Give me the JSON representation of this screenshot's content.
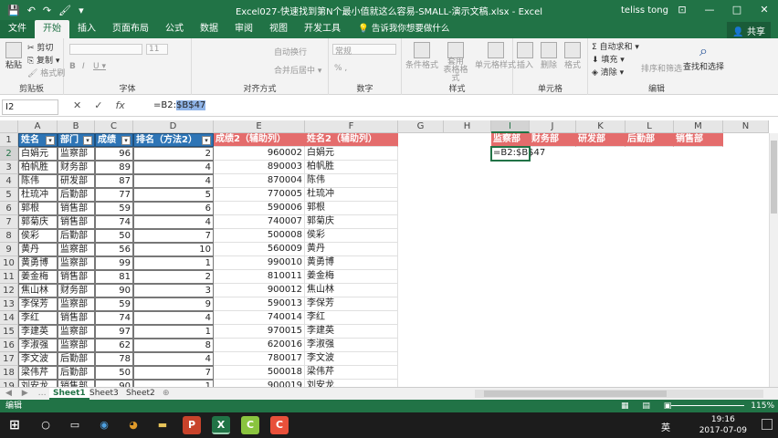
{
  "window": {
    "title": "Excel027-快速找到第N个最小值就这么容易-SMALL-演示文稿.xlsx  -  Excel",
    "user": "teliss tong",
    "minimize": "—",
    "maximize": "□",
    "close": "✕",
    "ribbon_opts": "⊡"
  },
  "quick_access": {
    "save_icon": "💾",
    "undo_icon": "↶",
    "redo_icon": "↷",
    "brush_icon": "🖌",
    "more_icon": "▾"
  },
  "tabs": [
    "文件",
    "开始",
    "插入",
    "页面布局",
    "公式",
    "数据",
    "审阅",
    "视图",
    "开发工具"
  ],
  "tell_me": "💡 告诉我你想要做什么",
  "share": "👤 共享",
  "ribbon": {
    "clipboard": {
      "label": "剪贴板",
      "paste": "粘贴",
      "cut": "✂ 剪切",
      "copy": "⎘ 复制 ▾",
      "format_painter": "🖌 格式刷"
    },
    "font": {
      "label": "字体",
      "size": "11",
      "bold": "B",
      "italic": "I",
      "underline": "U ▾"
    },
    "alignment": {
      "label": "对齐方式",
      "wrap": "自动换行",
      "merge": "合并后居中 ▾"
    },
    "number": {
      "label": "数字",
      "format": "常规",
      "percent": "% ,"
    },
    "styles": {
      "label": "样式",
      "cond": "条件格式",
      "table": "套用\n表格格式",
      "cell_style": "单元格样式"
    },
    "cells": {
      "label": "单元格",
      "insert": "插入",
      "delete": "删除",
      "format": "格式"
    },
    "editing": {
      "label": "编辑",
      "autosum": "Σ 自动求和 ▾",
      "fill": "⬇ 填充 ▾",
      "clear": "◈ 清除 ▾",
      "sort": "排序和筛选",
      "find": "查找和选择"
    }
  },
  "formula_bar": {
    "name_box": "I2",
    "cancel": "✕",
    "enter": "✓",
    "fx": "fx",
    "formula_prefix": "=B2:",
    "formula_selected": "$B$47"
  },
  "columns": [
    "A",
    "B",
    "C",
    "D",
    "E",
    "F",
    "G",
    "H",
    "I",
    "J",
    "K",
    "L",
    "M",
    "N"
  ],
  "headers": {
    "a": "姓名",
    "b": "部门",
    "c": "成绩",
    "d": "排名（方法2）",
    "e": "成绩2（辅助列）",
    "f": "姓名2（辅助列）",
    "i": "监察部",
    "j": "财务部",
    "k": "研发部",
    "l": "后勤部",
    "m": "销售部"
  },
  "active_formula": "=B2:$B$47",
  "rows": [
    [
      "白娟元",
      "监察部",
      "96",
      "2",
      "960002",
      "白娟元"
    ],
    [
      "柏帆胜",
      "财务部",
      "89",
      "4",
      "890003",
      "柏帆胜"
    ],
    [
      "陈伟",
      "研发部",
      "87",
      "4",
      "870004",
      "陈伟"
    ],
    [
      "杜琉冲",
      "后勤部",
      "77",
      "5",
      "770005",
      "杜琉冲"
    ],
    [
      "郭根",
      "销售部",
      "59",
      "6",
      "590006",
      "郭根"
    ],
    [
      "郭菊庆",
      "销售部",
      "74",
      "4",
      "740007",
      "郭菊庆"
    ],
    [
      "侯彩",
      "后勤部",
      "50",
      "7",
      "500008",
      "侯彩"
    ],
    [
      "黄丹",
      "监察部",
      "56",
      "10",
      "560009",
      "黄丹"
    ],
    [
      "黄勇博",
      "监察部",
      "99",
      "1",
      "990010",
      "黄勇博"
    ],
    [
      "姜金梅",
      "销售部",
      "81",
      "2",
      "810011",
      "姜金梅"
    ],
    [
      "焦山林",
      "财务部",
      "90",
      "3",
      "900012",
      "焦山林"
    ],
    [
      "李保芳",
      "监察部",
      "59",
      "9",
      "590013",
      "李保芳"
    ],
    [
      "李红",
      "销售部",
      "74",
      "4",
      "740014",
      "李红"
    ],
    [
      "李建英",
      "监察部",
      "97",
      "1",
      "970015",
      "李建英"
    ],
    [
      "李淑强",
      "监察部",
      "62",
      "8",
      "620016",
      "李淑强"
    ],
    [
      "李文波",
      "后勤部",
      "78",
      "4",
      "780017",
      "李文波"
    ],
    [
      "梁伟芹",
      "后勤部",
      "50",
      "7",
      "500018",
      "梁伟芹"
    ],
    [
      "刘安龙",
      "销售部",
      "90",
      "1",
      "900019",
      "刘安龙"
    ]
  ],
  "sheet_tabs": [
    "Sheet1",
    "Sheet3",
    "Sheet2"
  ],
  "sheet_nav": "◀ ▶ …",
  "add_sheet": "⊕",
  "status": {
    "mode": "编辑",
    "zoom": "115%"
  },
  "taskbar": {
    "start": "⊞",
    "time": "19:16",
    "date": "2017-07-09",
    "ime": "英",
    "apps": [
      "○",
      "▭",
      "◉",
      "◕",
      "▬",
      "P",
      "X",
      "C",
      "C"
    ]
  },
  "colors": {
    "excel_green": "#217346",
    "header_blue": "#2e75b6",
    "header_red": "#e46c6c"
  }
}
